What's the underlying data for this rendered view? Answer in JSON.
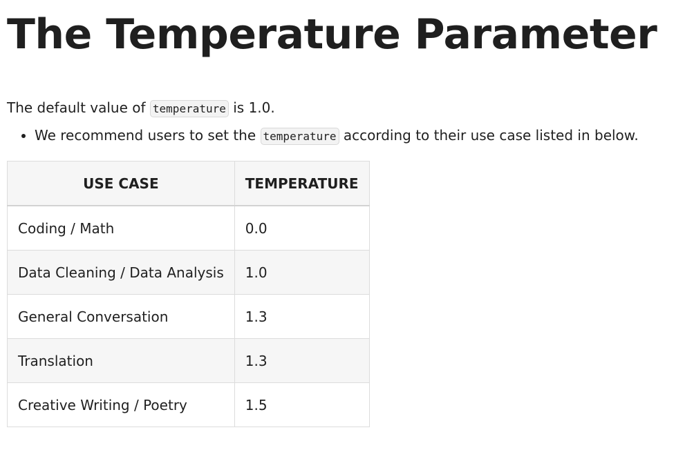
{
  "title": "The Temperature Parameter",
  "intro": {
    "prefix": "The default value of ",
    "code": "temperature",
    "suffix": " is 1.0."
  },
  "bullet": {
    "prefix": "We recommend users to set the ",
    "code": "temperature",
    "suffix": " according to their use case listed in below."
  },
  "table": {
    "headers": [
      "USE CASE",
      "TEMPERATURE"
    ],
    "rows": [
      [
        "Coding / Math",
        "0.0"
      ],
      [
        "Data Cleaning / Data Analysis",
        "1.0"
      ],
      [
        "General Conversation",
        "1.3"
      ],
      [
        "Translation",
        "1.3"
      ],
      [
        "Creative Writing / Poetry",
        "1.5"
      ]
    ]
  }
}
